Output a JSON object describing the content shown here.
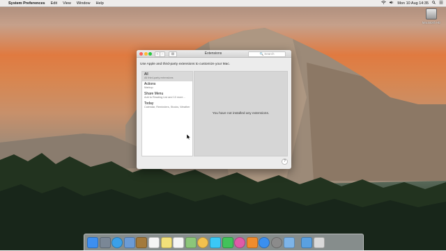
{
  "menubar": {
    "apple_glyph": "",
    "app_name": "System Preferences",
    "menus": [
      "Edit",
      "View",
      "Window",
      "Help"
    ],
    "clock": "Mon 10 Aug 14:35",
    "status_icons": [
      "wifi-icon",
      "volume-icon",
      "spotlight-icon",
      "notifications-icon"
    ]
  },
  "desktop": {
    "volume_label": "Macintosh HD"
  },
  "window": {
    "title": "Extensions",
    "back_glyph": "‹",
    "forward_glyph": "›",
    "grid_glyph": "⊞",
    "search_placeholder": "🔍 Search",
    "description": "Use Apple and third-party extensions to customize your Mac.",
    "sidebar": [
      {
        "title": "All",
        "subtitle": "All third-party extensions",
        "selected": true
      },
      {
        "title": "Actions",
        "subtitle": "Markup",
        "selected": false
      },
      {
        "title": "Share Menu",
        "subtitle": "Add to Reading List and 10 more...",
        "selected": false
      },
      {
        "title": "Today",
        "subtitle": "Calendar, Reminders, Stocks, Weather",
        "selected": false
      }
    ],
    "empty_message": "You have not installed any extensions.",
    "help_glyph": "?"
  },
  "dock": {
    "icons": [
      {
        "name": "finder-icon",
        "color": "#3d8ff0"
      },
      {
        "name": "launchpad-icon",
        "color": "#7a8796"
      },
      {
        "name": "safari-icon",
        "color": "#3aa0e8"
      },
      {
        "name": "photo-icon",
        "color": "#6b9bd6"
      },
      {
        "name": "notefile-icon",
        "color": "#a37a3c"
      },
      {
        "name": "calendar-icon",
        "color": "#f5f5f5"
      },
      {
        "name": "notes-icon",
        "color": "#f2e07a"
      },
      {
        "name": "reminders-icon",
        "color": "#f5f5f5"
      },
      {
        "name": "maps-icon",
        "color": "#8cc67a"
      },
      {
        "name": "photos-icon",
        "color": "#f2c14e"
      },
      {
        "name": "messages-icon",
        "color": "#3bc8f5"
      },
      {
        "name": "facetime-icon",
        "color": "#42c25a"
      },
      {
        "name": "itunes-icon",
        "color": "#e05aa8"
      },
      {
        "name": "ibooks-icon",
        "color": "#f08c2c"
      },
      {
        "name": "app-store-icon",
        "color": "#3a8ff0"
      },
      {
        "name": "system-preferences-icon",
        "color": "#8b8b8b"
      },
      {
        "name": "downloads-folder-icon",
        "color": "#7db4e8"
      },
      {
        "name": "downloads-stack-icon",
        "color": "#5aa0e0"
      },
      {
        "name": "trash-icon",
        "color": "#d9d9d9"
      }
    ]
  }
}
